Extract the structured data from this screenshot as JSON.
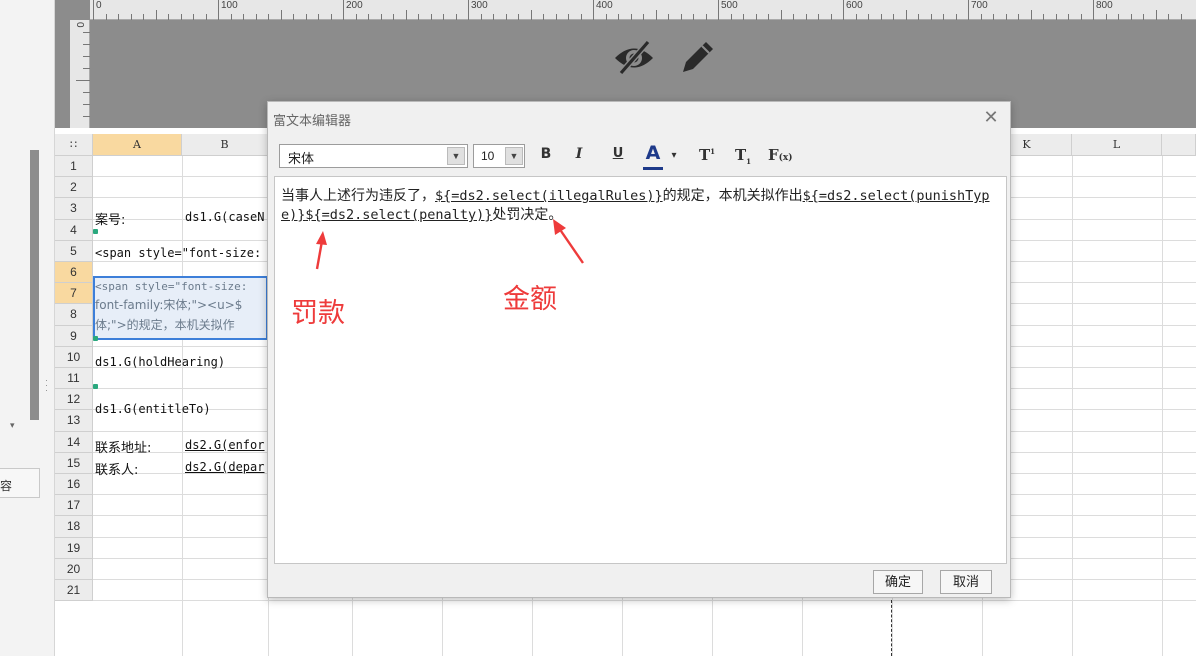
{
  "left_panel": {
    "tab_label": "容",
    "arrow": "▾"
  },
  "ruler": {
    "labels": [
      "0",
      "100",
      "200",
      "300",
      "400",
      "500",
      "600",
      "700",
      "800"
    ],
    "left_label": "0"
  },
  "design_icons": [
    "eye-off-icon",
    "pencil-icon"
  ],
  "spreadsheet": {
    "corner": "∷",
    "columns_visible_left": [
      "A",
      "B"
    ],
    "columns_visible_right": [
      "K",
      "L"
    ],
    "rows": [
      "1",
      "2",
      "3",
      "4",
      "5",
      "6",
      "7",
      "8",
      "9",
      "10",
      "11",
      "12",
      "13",
      "14",
      "15",
      "16",
      "17",
      "18",
      "19",
      "20",
      "21"
    ],
    "cells": {
      "a3": "案号:",
      "b3": "ds1.G(caseN",
      "a45": "<span style=\"font-size:",
      "a67_line1": "<span style=\"font-size:",
      "a67_line2": "font-family:宋体;\"><u>$",
      "a67_line3": "体;\">的规定，本机关拟作",
      "a89": "ds1.G(holdHearing)",
      "a1011": "ds1.G(entitleTo)",
      "a12": "联系地址:",
      "b12": "ds2.G(enfor",
      "a13": "联系人:",
      "b13": "ds2.G(depar"
    }
  },
  "dialog": {
    "title": "富文本编辑器",
    "close": "✕",
    "font_family": "宋体",
    "font_size": "10",
    "toolbar": {
      "bold": "B",
      "italic": "I",
      "underline": "U",
      "font_color": "A",
      "superscript": "T",
      "subscript": "T",
      "formula": "F"
    },
    "editor": {
      "text_1": "当事人上述行为违反了，",
      "tpl_1": "${=ds2.select(illegalRules)}",
      "text_2": "的规定，本机关拟作出",
      "tpl_2": "${=ds2.select(punishType)}",
      "tpl_3": "${=ds2.select(penalty)}",
      "text_3": "处罚决定。"
    },
    "annotations": {
      "penalty_label": "罚款",
      "amount_label": "金额",
      "color": "#ee3b3b"
    },
    "ok": "确定",
    "cancel": "取消"
  },
  "colors": {
    "selection_header": "#f9d9a0",
    "selection_border": "#3d7fd9",
    "design_bg": "#8c8c8c"
  }
}
